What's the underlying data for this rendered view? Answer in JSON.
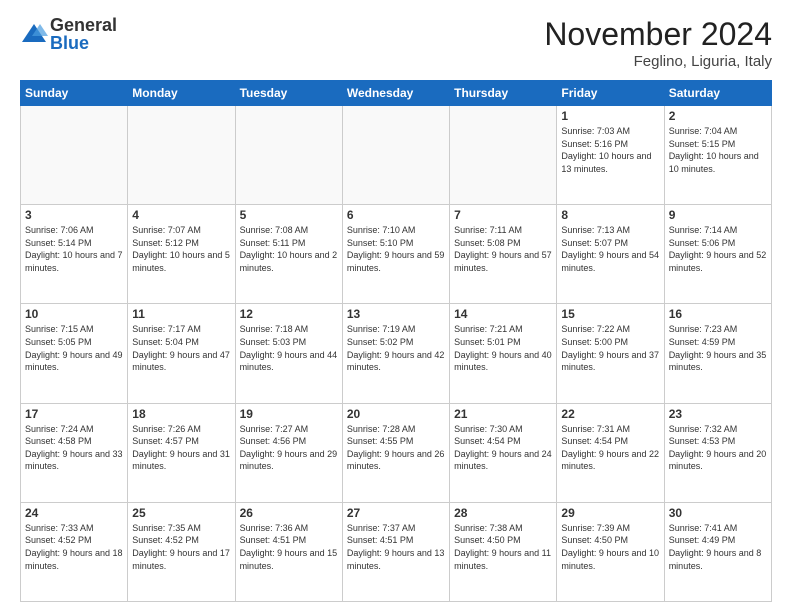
{
  "logo": {
    "general": "General",
    "blue": "Blue"
  },
  "header": {
    "month": "November 2024",
    "location": "Feglino, Liguria, Italy"
  },
  "weekdays": [
    "Sunday",
    "Monday",
    "Tuesday",
    "Wednesday",
    "Thursday",
    "Friday",
    "Saturday"
  ],
  "weeks": [
    [
      {
        "day": "",
        "info": ""
      },
      {
        "day": "",
        "info": ""
      },
      {
        "day": "",
        "info": ""
      },
      {
        "day": "",
        "info": ""
      },
      {
        "day": "",
        "info": ""
      },
      {
        "day": "1",
        "info": "Sunrise: 7:03 AM\nSunset: 5:16 PM\nDaylight: 10 hours\nand 13 minutes."
      },
      {
        "day": "2",
        "info": "Sunrise: 7:04 AM\nSunset: 5:15 PM\nDaylight: 10 hours\nand 10 minutes."
      }
    ],
    [
      {
        "day": "3",
        "info": "Sunrise: 7:06 AM\nSunset: 5:14 PM\nDaylight: 10 hours\nand 7 minutes."
      },
      {
        "day": "4",
        "info": "Sunrise: 7:07 AM\nSunset: 5:12 PM\nDaylight: 10 hours\nand 5 minutes."
      },
      {
        "day": "5",
        "info": "Sunrise: 7:08 AM\nSunset: 5:11 PM\nDaylight: 10 hours\nand 2 minutes."
      },
      {
        "day": "6",
        "info": "Sunrise: 7:10 AM\nSunset: 5:10 PM\nDaylight: 9 hours\nand 59 minutes."
      },
      {
        "day": "7",
        "info": "Sunrise: 7:11 AM\nSunset: 5:08 PM\nDaylight: 9 hours\nand 57 minutes."
      },
      {
        "day": "8",
        "info": "Sunrise: 7:13 AM\nSunset: 5:07 PM\nDaylight: 9 hours\nand 54 minutes."
      },
      {
        "day": "9",
        "info": "Sunrise: 7:14 AM\nSunset: 5:06 PM\nDaylight: 9 hours\nand 52 minutes."
      }
    ],
    [
      {
        "day": "10",
        "info": "Sunrise: 7:15 AM\nSunset: 5:05 PM\nDaylight: 9 hours\nand 49 minutes."
      },
      {
        "day": "11",
        "info": "Sunrise: 7:17 AM\nSunset: 5:04 PM\nDaylight: 9 hours\nand 47 minutes."
      },
      {
        "day": "12",
        "info": "Sunrise: 7:18 AM\nSunset: 5:03 PM\nDaylight: 9 hours\nand 44 minutes."
      },
      {
        "day": "13",
        "info": "Sunrise: 7:19 AM\nSunset: 5:02 PM\nDaylight: 9 hours\nand 42 minutes."
      },
      {
        "day": "14",
        "info": "Sunrise: 7:21 AM\nSunset: 5:01 PM\nDaylight: 9 hours\nand 40 minutes."
      },
      {
        "day": "15",
        "info": "Sunrise: 7:22 AM\nSunset: 5:00 PM\nDaylight: 9 hours\nand 37 minutes."
      },
      {
        "day": "16",
        "info": "Sunrise: 7:23 AM\nSunset: 4:59 PM\nDaylight: 9 hours\nand 35 minutes."
      }
    ],
    [
      {
        "day": "17",
        "info": "Sunrise: 7:24 AM\nSunset: 4:58 PM\nDaylight: 9 hours\nand 33 minutes."
      },
      {
        "day": "18",
        "info": "Sunrise: 7:26 AM\nSunset: 4:57 PM\nDaylight: 9 hours\nand 31 minutes."
      },
      {
        "day": "19",
        "info": "Sunrise: 7:27 AM\nSunset: 4:56 PM\nDaylight: 9 hours\nand 29 minutes."
      },
      {
        "day": "20",
        "info": "Sunrise: 7:28 AM\nSunset: 4:55 PM\nDaylight: 9 hours\nand 26 minutes."
      },
      {
        "day": "21",
        "info": "Sunrise: 7:30 AM\nSunset: 4:54 PM\nDaylight: 9 hours\nand 24 minutes."
      },
      {
        "day": "22",
        "info": "Sunrise: 7:31 AM\nSunset: 4:54 PM\nDaylight: 9 hours\nand 22 minutes."
      },
      {
        "day": "23",
        "info": "Sunrise: 7:32 AM\nSunset: 4:53 PM\nDaylight: 9 hours\nand 20 minutes."
      }
    ],
    [
      {
        "day": "24",
        "info": "Sunrise: 7:33 AM\nSunset: 4:52 PM\nDaylight: 9 hours\nand 18 minutes."
      },
      {
        "day": "25",
        "info": "Sunrise: 7:35 AM\nSunset: 4:52 PM\nDaylight: 9 hours\nand 17 minutes."
      },
      {
        "day": "26",
        "info": "Sunrise: 7:36 AM\nSunset: 4:51 PM\nDaylight: 9 hours\nand 15 minutes."
      },
      {
        "day": "27",
        "info": "Sunrise: 7:37 AM\nSunset: 4:51 PM\nDaylight: 9 hours\nand 13 minutes."
      },
      {
        "day": "28",
        "info": "Sunrise: 7:38 AM\nSunset: 4:50 PM\nDaylight: 9 hours\nand 11 minutes."
      },
      {
        "day": "29",
        "info": "Sunrise: 7:39 AM\nSunset: 4:50 PM\nDaylight: 9 hours\nand 10 minutes."
      },
      {
        "day": "30",
        "info": "Sunrise: 7:41 AM\nSunset: 4:49 PM\nDaylight: 9 hours\nand 8 minutes."
      }
    ]
  ]
}
